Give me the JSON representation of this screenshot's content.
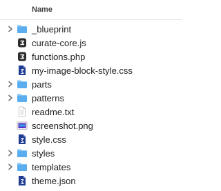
{
  "header": {
    "name_column": "Name"
  },
  "files": [
    {
      "label": "_blueprint",
      "kind": "folder",
      "expandable": true,
      "icon": "folder-icon"
    },
    {
      "label": "curate-core.js",
      "kind": "js",
      "expandable": false,
      "icon": "js-file-icon"
    },
    {
      "label": "functions.php",
      "kind": "php",
      "expandable": false,
      "icon": "php-file-icon"
    },
    {
      "label": "my-image-block-style.css",
      "kind": "css",
      "expandable": false,
      "icon": "css-file-icon"
    },
    {
      "label": "parts",
      "kind": "folder",
      "expandable": true,
      "icon": "folder-icon"
    },
    {
      "label": "patterns",
      "kind": "folder",
      "expandable": true,
      "icon": "folder-icon"
    },
    {
      "label": "readme.txt",
      "kind": "txt",
      "expandable": false,
      "icon": "text-file-icon"
    },
    {
      "label": "screenshot.png",
      "kind": "png",
      "expandable": false,
      "icon": "image-file-icon"
    },
    {
      "label": "style.css",
      "kind": "css",
      "expandable": false,
      "icon": "css-file-icon"
    },
    {
      "label": "styles",
      "kind": "folder",
      "expandable": true,
      "icon": "folder-icon"
    },
    {
      "label": "templates",
      "kind": "folder",
      "expandable": true,
      "icon": "folder-icon"
    },
    {
      "label": "theme.json",
      "kind": "json",
      "expandable": false,
      "icon": "json-file-icon"
    }
  ],
  "colors": {
    "folder": "#5aaef0",
    "folder_tab": "#7cc0f5",
    "css_icon": "#1f3c93",
    "code_icon": "#2c2c2e",
    "chevron": "#6e6e73"
  }
}
